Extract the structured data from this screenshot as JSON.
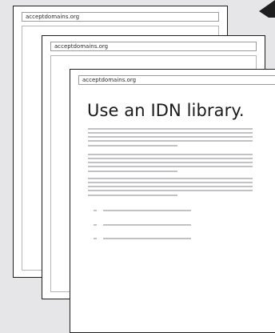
{
  "windows": [
    {
      "url": "acceptdomains.org"
    },
    {
      "url": "acceptdomains.org"
    },
    {
      "url": "acceptdomains.org"
    }
  ],
  "headline": "Use an IDN library.",
  "colors": {
    "background": "#e6e6e8",
    "window": "#ffffff",
    "border": "#1e1e1e",
    "placeholder_line": "#c2c2c4"
  },
  "icons": [
    "corner-triangle-icon"
  ]
}
